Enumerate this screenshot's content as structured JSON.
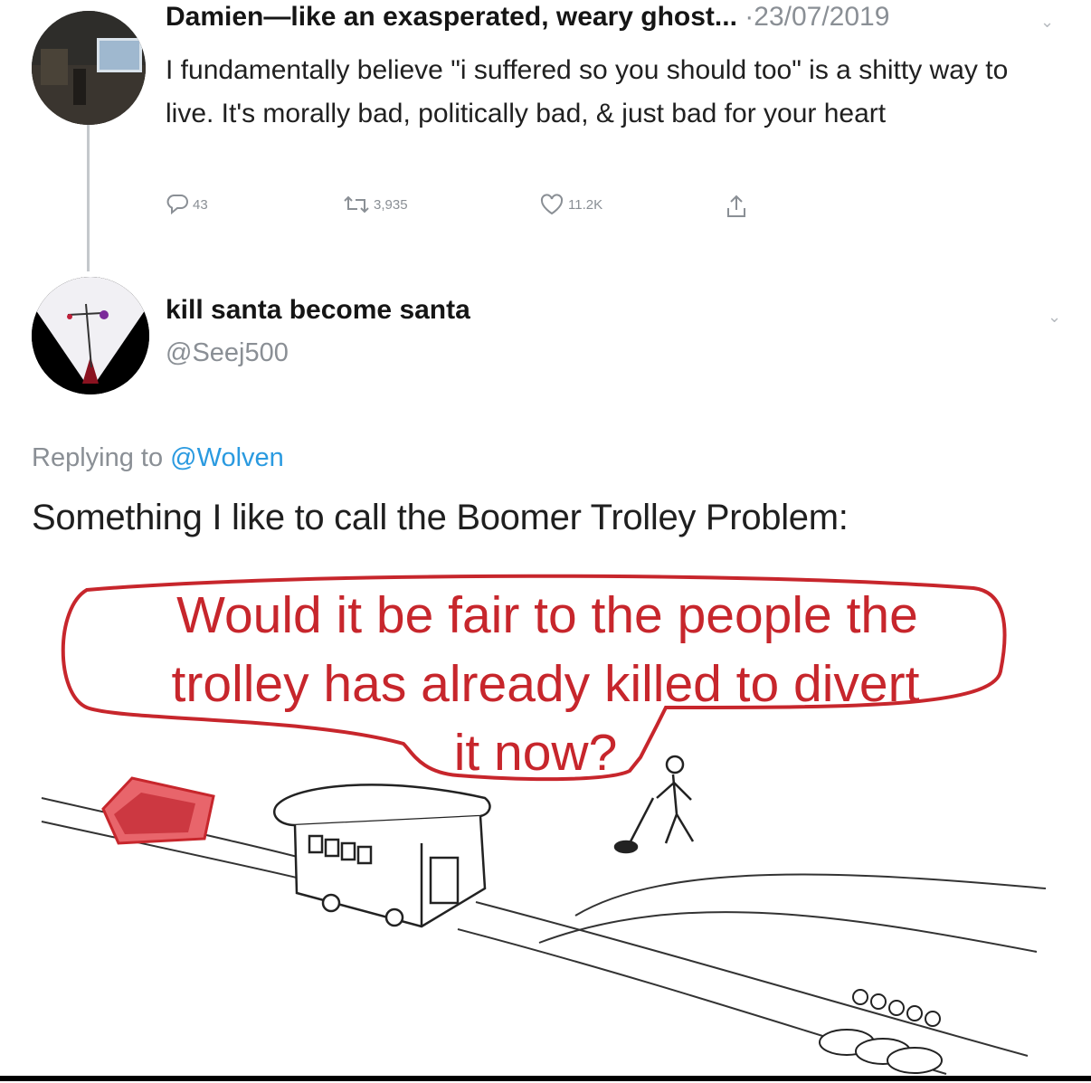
{
  "tweet1": {
    "display_name": "Damien—like an exasperated, weary ghost...",
    "date": "·23/07/2019",
    "body": "I fundamentally believe \"i suffered so you should too\" is a shitty way to live. It's morally bad, politically bad, & just bad for your heart",
    "replies": "43",
    "retweets": "3,935",
    "likes": "11.2K"
  },
  "tweet2": {
    "display_name": "kill santa become santa",
    "handle": "@Seej500",
    "replying_prefix": "Replying to",
    "replying_to": "@Wolven",
    "text": "Something I like to call the Boomer Trolley Problem:"
  },
  "meme": {
    "bubble_line1": "Would it be fair to the people the",
    "bubble_line2": "trolley has already killed to divert",
    "bubble_line3": "it now?",
    "accent_color": "#c7262c"
  }
}
